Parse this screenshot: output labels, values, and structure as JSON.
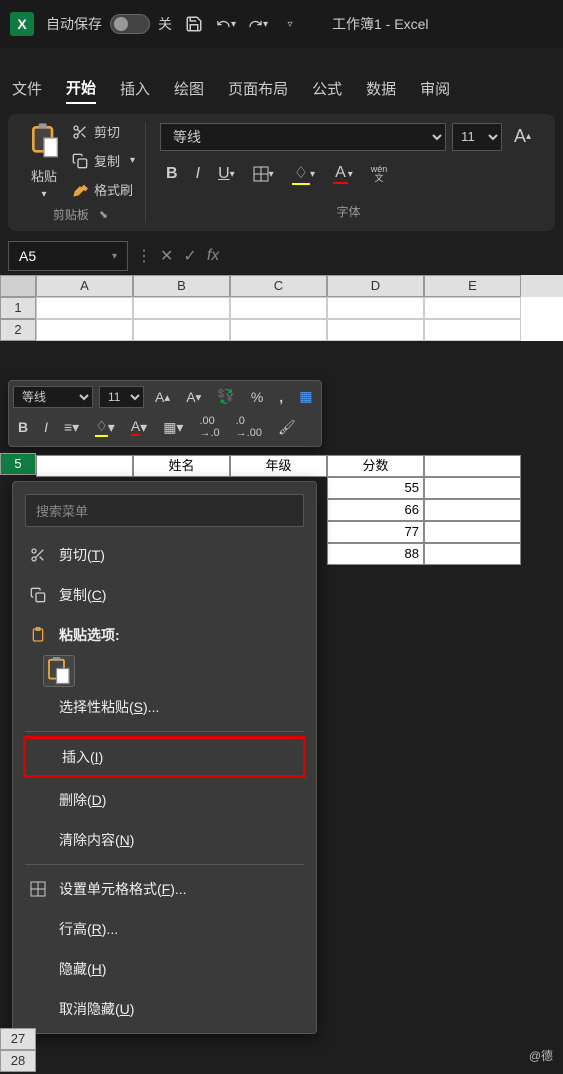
{
  "titlebar": {
    "autosave_label": "自动保存",
    "autosave_state": "关",
    "doc_title": "工作簿1 - Excel"
  },
  "ribbon_tabs": [
    "文件",
    "开始",
    "插入",
    "绘图",
    "页面布局",
    "公式",
    "数据",
    "审阅"
  ],
  "active_tab_index": 1,
  "clipboard_group": {
    "paste": "粘贴",
    "cut": "剪切",
    "copy": "复制",
    "format_painter": "格式刷",
    "group_label": "剪贴板"
  },
  "font_group": {
    "font_name": "等线",
    "font_size": "11",
    "group_label": "字体",
    "wen": "wén",
    "wen_cn": "文"
  },
  "namebox": {
    "value": "A5",
    "fx": "fx"
  },
  "columns": [
    "A",
    "B",
    "C",
    "D",
    "E"
  ],
  "row_numbers_top": [
    "1",
    "2"
  ],
  "selected_row": "5",
  "row_numbers_bottom": [
    "27",
    "28"
  ],
  "visible_data": {
    "headers": [
      "姓名",
      "年级",
      "分数"
    ],
    "scores": [
      "55",
      "66",
      "77",
      "88"
    ]
  },
  "mini_toolbar": {
    "font_name": "等线",
    "font_size": "11"
  },
  "context_menu": {
    "search_placeholder": "搜索菜单",
    "cut": "剪切(T)",
    "copy": "复制(C)",
    "paste_options": "粘贴选项:",
    "paste_special": "选择性粘贴(S)...",
    "insert": "插入(I)",
    "delete": "删除(D)",
    "clear": "清除内容(N)",
    "format_cells": "设置单元格格式(F)...",
    "row_height": "行高(R)...",
    "hide": "隐藏(H)",
    "unhide": "取消隐藏(U)"
  },
  "watermark": "@德"
}
